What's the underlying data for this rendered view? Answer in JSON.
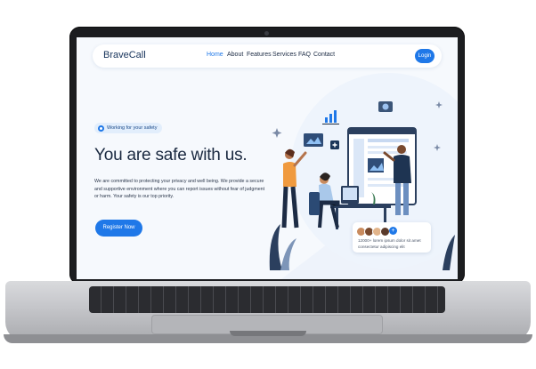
{
  "header": {
    "brand": "BraveCall",
    "nav": [
      {
        "label": "Home",
        "active": true
      },
      {
        "label": "About"
      },
      {
        "label": "Features"
      },
      {
        "label": "Services"
      },
      {
        "label": "FAQ"
      },
      {
        "label": "Contact"
      }
    ],
    "login_label": "Login"
  },
  "hero": {
    "badge": "Working for your safety",
    "title": "You are safe with us.",
    "description": "We are committed to protecting your privacy and well being. We provide a secure and supportive environment where you can report issues without fear of judgment or harm. Your safety is our top priority.",
    "cta_label": "Register Now"
  },
  "stat_card": {
    "line1": "12000+ lorem ipsum dolor sit amet",
    "line2": "consectetur adipiscing elit",
    "plus": "+"
  },
  "colors": {
    "accent": "#1f78e8",
    "heading": "#1a2940",
    "background": "#f6f9fd"
  }
}
